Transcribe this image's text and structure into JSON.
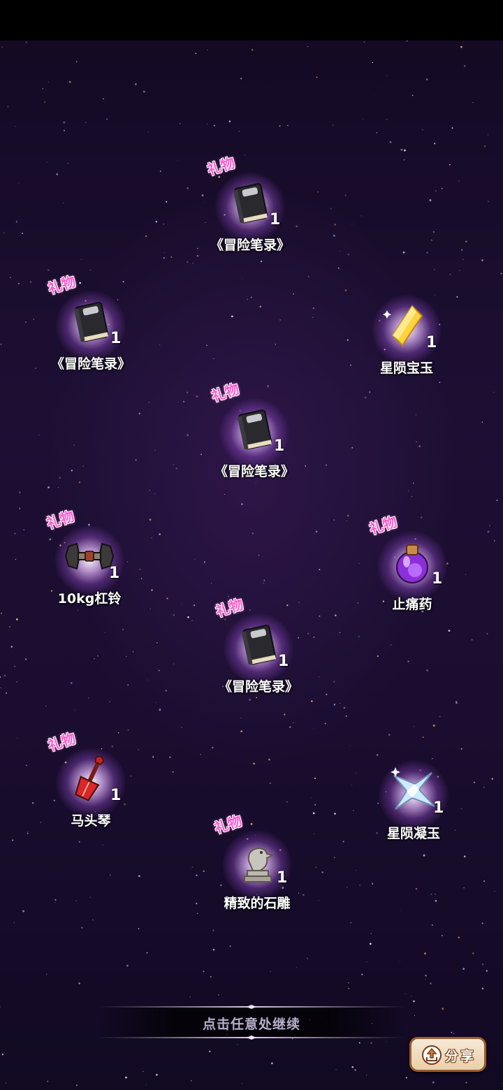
{
  "rewards": [
    {
      "name": "《冒险笔录》",
      "count": "1",
      "tag": "礼物",
      "icon": "book-icon"
    },
    {
      "name": "《冒险笔录》",
      "count": "1",
      "tag": "礼物",
      "icon": "book-icon"
    },
    {
      "name": "星陨宝玉",
      "count": "1",
      "tag": "",
      "icon": "yellow-gem-icon"
    },
    {
      "name": "《冒险笔录》",
      "count": "1",
      "tag": "礼物",
      "icon": "book-icon"
    },
    {
      "name": "10kg杠铃",
      "count": "1",
      "tag": "礼物",
      "icon": "dumbbell-icon"
    },
    {
      "name": "止痛药",
      "count": "1",
      "tag": "礼物",
      "icon": "potion-bottle-icon"
    },
    {
      "name": "《冒险笔录》",
      "count": "1",
      "tag": "礼物",
      "icon": "book-icon"
    },
    {
      "name": "马头琴",
      "count": "1",
      "tag": "礼物",
      "icon": "horsehead-fiddle-icon"
    },
    {
      "name": "星陨凝玉",
      "count": "1",
      "tag": "",
      "icon": "star-crystal-icon"
    },
    {
      "name": "精致的石雕",
      "count": "1",
      "tag": "礼物",
      "icon": "stone-bird-statue-icon"
    }
  ],
  "continue_text": "点击任意处继续",
  "share": {
    "label": "分享",
    "icon": "share-icon"
  },
  "colors": {
    "gift_tag": "#ff5fd0",
    "glow": "#e8beff",
    "background": "#1d0f33"
  }
}
